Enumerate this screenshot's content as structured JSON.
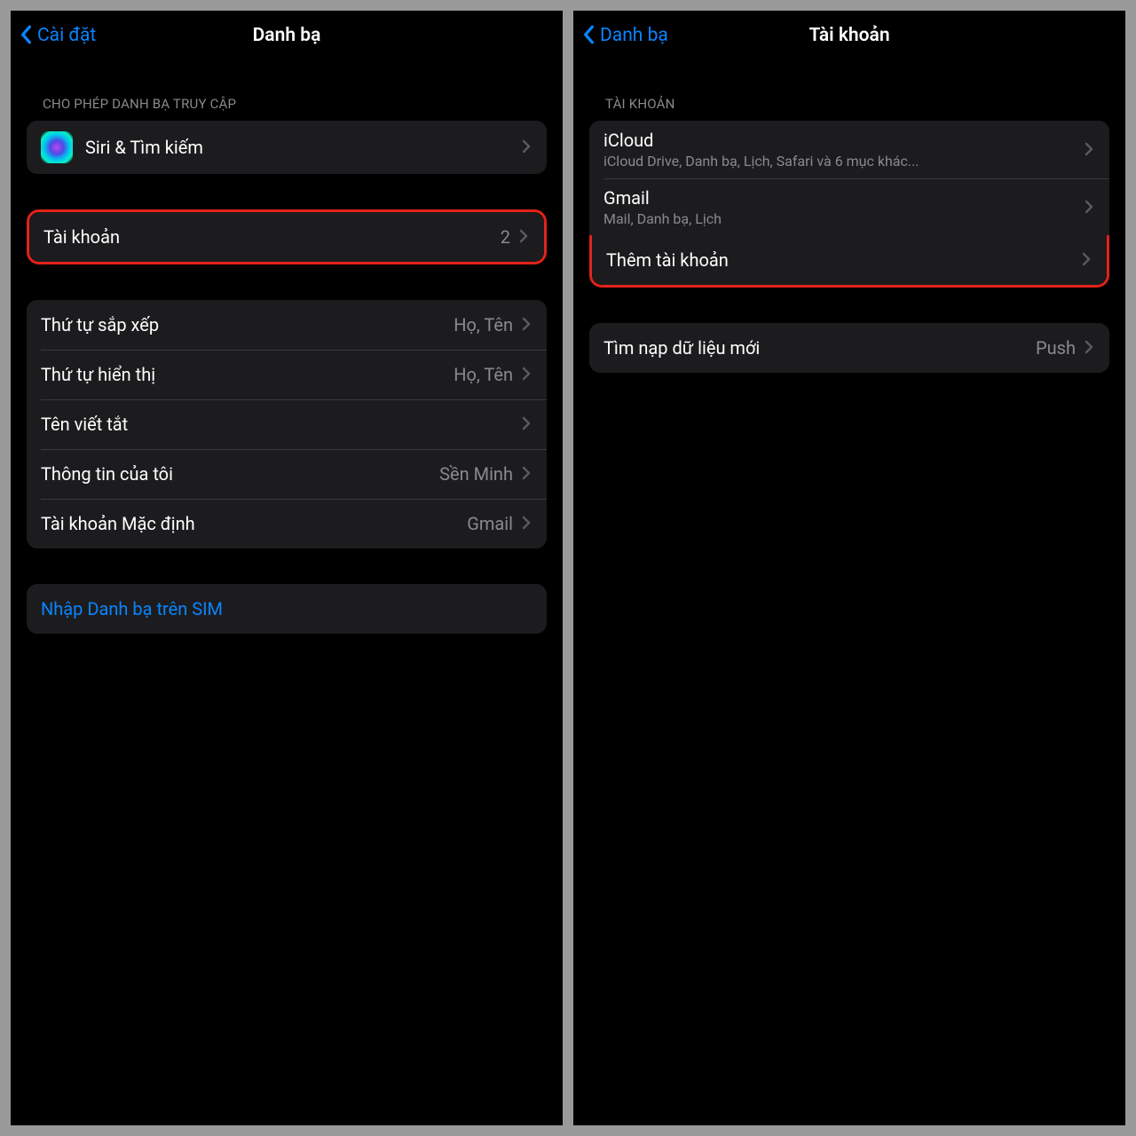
{
  "left": {
    "nav": {
      "back": "Cài đặt",
      "title": "Danh bạ"
    },
    "section1": {
      "header": "CHO PHÉP DANH BẠ TRUY CẬP",
      "siri": "Siri & Tìm kiếm"
    },
    "accounts": {
      "label": "Tài khoản",
      "value": "2"
    },
    "options": {
      "sort": {
        "label": "Thứ tự sắp xếp",
        "value": "Họ, Tên"
      },
      "display": {
        "label": "Thứ tự hiển thị",
        "value": "Họ, Tên"
      },
      "shortname": {
        "label": "Tên viết tắt"
      },
      "myinfo": {
        "label": "Thông tin của tôi",
        "value": "Sền Minh"
      },
      "default": {
        "label": "Tài khoản Mặc định",
        "value": "Gmail"
      }
    },
    "sim": {
      "label": "Nhập Danh bạ trên SIM"
    }
  },
  "right": {
    "nav": {
      "back": "Danh bạ",
      "title": "Tài khoản"
    },
    "section1": {
      "header": "TÀI KHOẢN",
      "icloud": {
        "label": "iCloud",
        "sub": "iCloud Drive, Danh bạ, Lịch, Safari và 6 mục khác..."
      },
      "gmail": {
        "label": "Gmail",
        "sub": "Mail, Danh bạ, Lịch"
      },
      "add": {
        "label": "Thêm tài khoản"
      }
    },
    "fetch": {
      "label": "Tìm nạp dữ liệu mới",
      "value": "Push"
    }
  }
}
